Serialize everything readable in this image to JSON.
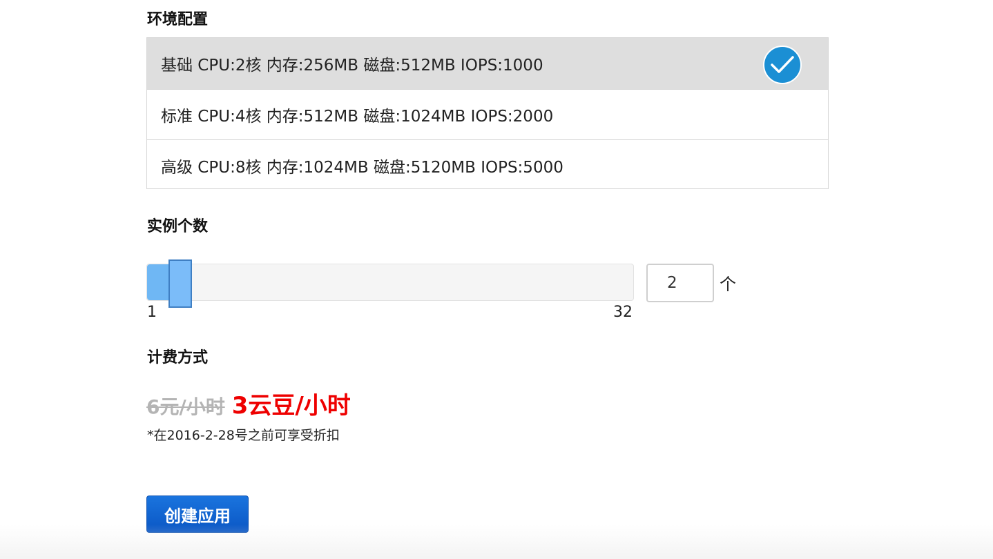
{
  "environment": {
    "title": "环境配置",
    "options": [
      {
        "label": "基础 CPU:2核 内存:256MB 磁盘:512MB IOPS:1000",
        "selected": true
      },
      {
        "label": "标准 CPU:4核 内存:512MB 磁盘:1024MB IOPS:2000",
        "selected": false
      },
      {
        "label": "高级 CPU:8核 内存:1024MB 磁盘:5120MB IOPS:5000",
        "selected": false
      }
    ]
  },
  "instances": {
    "title": "实例个数",
    "min_label": "1",
    "max_label": "32",
    "min": 1,
    "max": 32,
    "value": "2",
    "unit": "个"
  },
  "billing": {
    "title": "计费方式",
    "old_price": "6元/小时",
    "new_price": "3云豆/小时",
    "note": "*在2016-2-28号之前可享受折扣"
  },
  "actions": {
    "create_label": "创建应用"
  },
  "colors": {
    "selected_bg": "#dedede",
    "check_badge": "#1b8fd4",
    "slider_fill": "#6fb7f4",
    "price_new": "#ee0000",
    "price_old": "#b4b4b4",
    "button": "#0a56c4"
  },
  "icons": {
    "check": "checkmark-icon"
  }
}
